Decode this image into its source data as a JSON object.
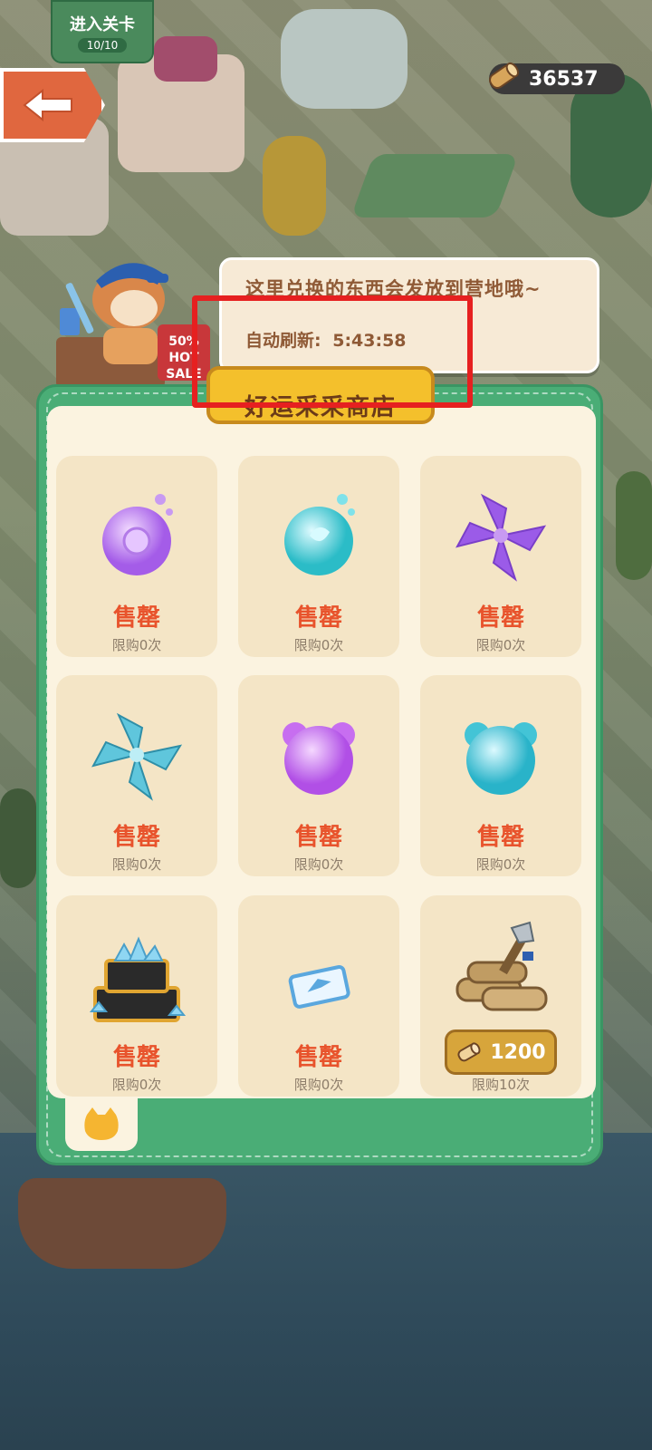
{
  "level_badge": {
    "title": "进入关卡",
    "progress": "10/10"
  },
  "currency": {
    "icon": "log-wood-icon",
    "value": "36537"
  },
  "speech": {
    "message": "这里兑换的东西会发放到营地哦~",
    "refresh_label": "自动刷新:",
    "refresh_time": "5:43:58"
  },
  "sale_sign": {
    "line1": "50%",
    "line2": "HOT",
    "line3": "SALE"
  },
  "shop": {
    "title": "好运采采商店",
    "items": [
      {
        "icon": "purple-rose-orb-icon",
        "status": "售罄",
        "limit": "限购0次"
      },
      {
        "icon": "cyan-leaf-orb-icon",
        "status": "售罄",
        "limit": "限购0次"
      },
      {
        "icon": "purple-pinwheel-icon",
        "status": "售罄",
        "limit": "限购0次"
      },
      {
        "icon": "cyan-pinwheel-icon",
        "status": "售罄",
        "limit": "限购0次"
      },
      {
        "icon": "purple-bear-bubble-icon",
        "status": "售罄",
        "limit": "限购0次"
      },
      {
        "icon": "cyan-bear-bubble-icon",
        "status": "售罄",
        "limit": "限购0次"
      },
      {
        "icon": "diamond-chest-icon",
        "status": "售罄",
        "limit": "限购0次"
      },
      {
        "icon": "ticket-icon",
        "status": "售罄",
        "limit": "限购0次"
      },
      {
        "icon": "wood-logs-axe-icon",
        "price": "1200",
        "limit": "限购10次"
      }
    ]
  },
  "colors": {
    "accent_green": "#4aad76",
    "sold_out_red": "#e8532c",
    "highlight_red": "#e62020",
    "gold": "#f4c02c"
  }
}
